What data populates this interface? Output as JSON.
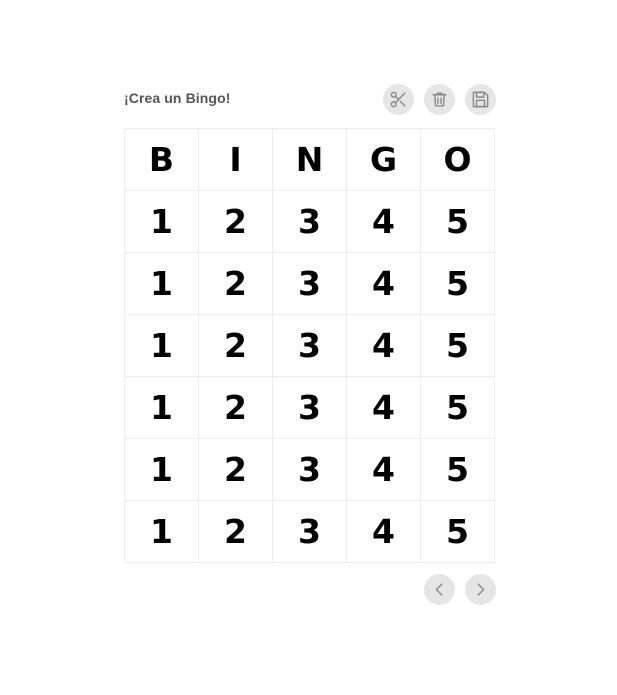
{
  "header": {
    "title": "¡Crea un Bingo!"
  },
  "toolbar": {
    "buttons": [
      {
        "name": "cut-button",
        "icon": "scissors-icon"
      },
      {
        "name": "delete-button",
        "icon": "trash-icon"
      },
      {
        "name": "save-button",
        "icon": "floppy-disk-icon"
      }
    ]
  },
  "bingo": {
    "headers": [
      "B",
      "I",
      "N",
      "G",
      "O"
    ],
    "rows": [
      [
        "1",
        "2",
        "3",
        "4",
        "5"
      ],
      [
        "1",
        "2",
        "3",
        "4",
        "5"
      ],
      [
        "1",
        "2",
        "3",
        "4",
        "5"
      ],
      [
        "1",
        "2",
        "3",
        "4",
        "5"
      ],
      [
        "1",
        "2",
        "3",
        "4",
        "5"
      ],
      [
        "1",
        "2",
        "3",
        "4",
        "5"
      ]
    ]
  },
  "pager": {
    "buttons": [
      {
        "name": "previous-button",
        "icon": "chevron-left-icon"
      },
      {
        "name": "next-button",
        "icon": "chevron-right-icon"
      }
    ]
  },
  "colors": {
    "button_bg": "#e6e6e6",
    "icon": "#8a8a8a",
    "grid_line": "#ececec"
  }
}
